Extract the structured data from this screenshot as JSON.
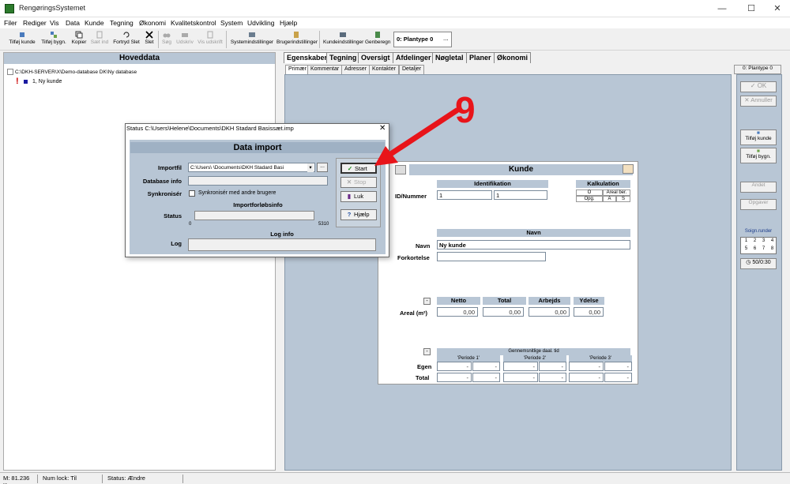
{
  "window": {
    "title": "RengøringsSystemet"
  },
  "menu": [
    "Filer",
    "Rediger",
    "Vis",
    "Data",
    "Kunde",
    "Tegning",
    "Økonomi",
    "Kvalitetskontrol",
    "System",
    "Udvikling",
    "Hjælp"
  ],
  "toolbar": {
    "buttons": [
      "Tilføj kunde",
      "Tilføj bygn.",
      "Kopier",
      "Sæt ind",
      "Fortryd Slet",
      "Slet",
      "Søg",
      "Udskriv",
      "Vis udskrift",
      "Systemindstillinger",
      "Brugerindstillinger",
      "Kundeindstillinger",
      "Genberegn"
    ],
    "plant_label": "0: Plantype 0",
    "plant_btn": "..."
  },
  "left": {
    "header": "Hoveddata",
    "root": "C:\\DKH-SERVER\\X\\Demo-database DK\\Ny database",
    "item": "1, Ny kunde"
  },
  "tabs": [
    "Egenskaber",
    "Tegning",
    "Oversigt",
    "Afdelinger",
    "Nøgletal",
    "Planer",
    "Økonomi"
  ],
  "subtabs": [
    "Primær",
    "Kommentar",
    "Adresser",
    "Kontakter",
    "Detaljer"
  ],
  "kunde": {
    "title": "Kunde",
    "ident_header": "Identifikation",
    "id_label": "ID/Nummer",
    "id1": "1",
    "id2": "1",
    "kalk_header": "Kalkulation",
    "kalk_o": "O",
    "kalk_areal": "Areal ber.",
    "kalk_opg": "Opg.",
    "kalk_a": "A",
    "kalk_s": "S",
    "navn_header": "Navn",
    "navn_label": "Navn",
    "navn_value": "Ny kunde",
    "fork_label": "Forkortelse",
    "netto": "Netto",
    "total": "Total",
    "arbejds": "Arbejds",
    "ydelse": "Ydelse",
    "areal_label": "Areal (m²)",
    "areal_values": [
      "0,00",
      "0,00",
      "0,00",
      "0,00"
    ],
    "gns_header": "Gennemsnitlige daal. tid",
    "perioder": [
      "'Periode 1'",
      "'Periode 2'",
      "'Periode 3'"
    ],
    "egen_label": "Egen",
    "total_label": "Total",
    "dash": "-"
  },
  "right": {
    "tab": "0: Plantype 0",
    "ok": "OK",
    "annuller": "Annuller",
    "tilfoj_kunde": "Tilføj kunde",
    "tilfoj_bygn": "Tilføj bygn.",
    "andet": "Andet",
    "opgaver": "Opgaver",
    "soign": "Soign.runder",
    "nums": [
      "1",
      "2",
      "3",
      "4",
      "5",
      "6",
      "7",
      "8"
    ],
    "rate": "50/0:30"
  },
  "status": [
    "M: 81.236 K",
    "Num lock: Til",
    "Status: Ændre"
  ],
  "dialog": {
    "title": "Status  C:\\Users\\Helene\\Documents\\DKH Stadard Basissæt.imp",
    "heading": "Data import",
    "importfil_label": "Importfil",
    "importfil_value": "C:\\Users\\          \\Documents\\DKH Stadard Basi",
    "browse": "...",
    "dbinfo_label": "Database info",
    "sync_label": "Synkronisér",
    "sync_text": "Synkronisér med andre brugere",
    "progress_header": "Importforløbsinfo",
    "status_label": "Status",
    "prog_min": "0",
    "prog_max": "5310",
    "log_header": "Log info",
    "log_label": "Log",
    "start": "Start",
    "stop": "Stop",
    "luk": "Luk",
    "hjaelp": "Hjælp"
  },
  "annotation": {
    "number": "9",
    "color": "#e8141a"
  }
}
